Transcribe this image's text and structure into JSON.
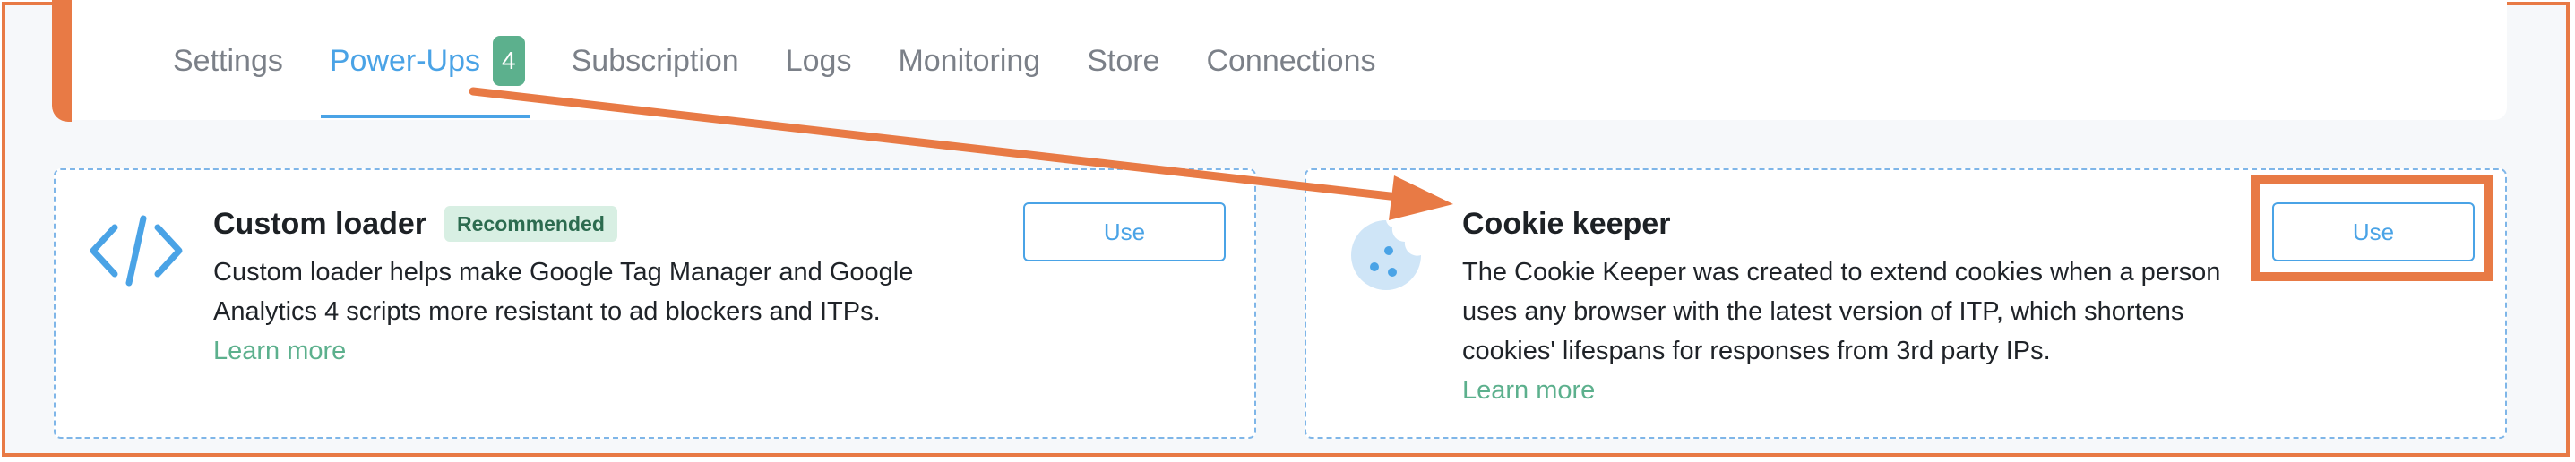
{
  "tabs": [
    {
      "label": "Settings",
      "active": false
    },
    {
      "label": "Power-Ups",
      "active": true,
      "badge": "4"
    },
    {
      "label": "Subscription",
      "active": false
    },
    {
      "label": "Logs",
      "active": false
    },
    {
      "label": "Monitoring",
      "active": false
    },
    {
      "label": "Store",
      "active": false
    },
    {
      "label": "Connections",
      "active": false
    }
  ],
  "cards": [
    {
      "title": "Custom loader",
      "badge": "Recommended",
      "description": "Custom loader helps make Google Tag Manager and Google Analytics 4 scripts more resistant to ad blockers and ITPs.",
      "link": "Learn more",
      "button": "Use",
      "icon": "code-icon"
    },
    {
      "title": "Cookie keeper",
      "description": "The Cookie Keeper was created to extend cookies when a person uses any browser with the latest version of ITP, which shortens cookies' lifespans for responses from 3rd party IPs.",
      "link": "Learn more",
      "button": "Use",
      "icon": "cookie-icon"
    }
  ],
  "colors": {
    "accent": "#4aa3e6",
    "badge": "#5cb08d",
    "annotation": "#e87a45",
    "recommended_bg": "#d8efe3"
  }
}
